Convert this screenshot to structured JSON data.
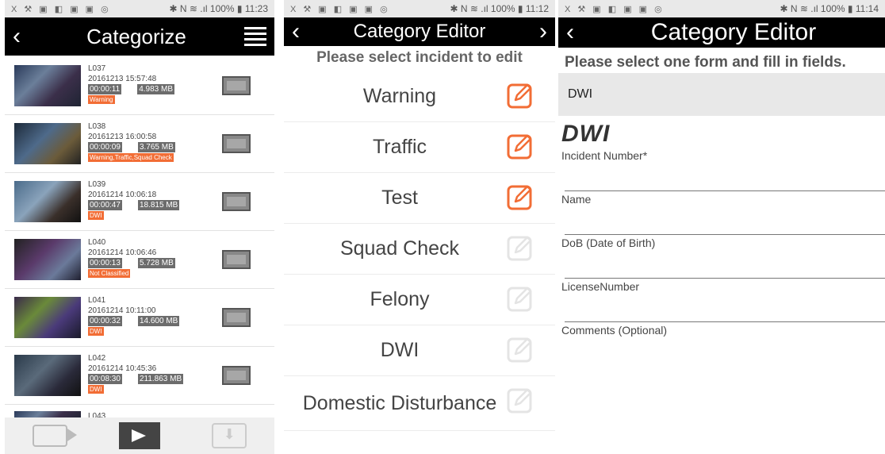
{
  "panel1": {
    "status": {
      "icons": "X ⚒ ▣ ◧ ▣ ▣ ◎",
      "right": "✱ N ≋ .ıl 100% ▮ 11:23"
    },
    "title": "Categorize",
    "records": [
      {
        "id": "L037",
        "datetime": "20161213 15:57:48",
        "duration": "00:00:11",
        "size": "4.983 MB",
        "category": "Warning"
      },
      {
        "id": "L038",
        "datetime": "20161213 16:00:58",
        "duration": "00:00:09",
        "size": "3.765 MB",
        "category": "Warning,Traffic,Squad Check"
      },
      {
        "id": "L039",
        "datetime": "20161214 10:06:18",
        "duration": "00:00:47",
        "size": "18.815 MB",
        "category": "DWI"
      },
      {
        "id": "L040",
        "datetime": "20161214 10:06:46",
        "duration": "00:00:13",
        "size": "5.728 MB",
        "category": "Not Classified"
      },
      {
        "id": "L041",
        "datetime": "20161214 10:11:00",
        "duration": "00:00:32",
        "size": "14.600 MB",
        "category": "DWI"
      },
      {
        "id": "L042",
        "datetime": "20161214 10:45:36",
        "duration": "00:08:30",
        "size": "211.863 MB",
        "category": "DWI"
      }
    ],
    "partial_record": {
      "id": "L043"
    }
  },
  "panel2": {
    "status": {
      "icons": "X ⚒ ▣ ◧ ▣ ▣ ◎",
      "right": "✱ N ≋ .ıl 100% ▮ 11:12"
    },
    "title": "Category Editor",
    "subtitle": "Please select incident to edit",
    "categories": [
      {
        "label": "Warning",
        "enabled": true
      },
      {
        "label": "Traffic",
        "enabled": true
      },
      {
        "label": "Test",
        "enabled": true
      },
      {
        "label": "Squad Check",
        "enabled": false
      },
      {
        "label": "Felony",
        "enabled": false
      },
      {
        "label": "DWI",
        "enabled": false
      },
      {
        "label": "Domestic Disturbance",
        "enabled": false
      }
    ],
    "colors": {
      "accent": "#f26d35",
      "disabled": "#e4e4e4"
    }
  },
  "panel3": {
    "status": {
      "icons": "X ⚒ ▣ ◧ ▣ ▣ ◎",
      "right": "✱ N ≋ .ıl 100% ▮ 11:14"
    },
    "title": "Category Editor",
    "subtitle": "Please select one form and fill in fields.",
    "selected_form": "DWI",
    "form_heading": "DWI",
    "fields": [
      {
        "label": "Incident Number*"
      },
      {
        "label": "Name"
      },
      {
        "label": "DoB (Date of Birth)"
      },
      {
        "label": "LicenseNumber"
      },
      {
        "label": "Comments (Optional)"
      }
    ]
  }
}
